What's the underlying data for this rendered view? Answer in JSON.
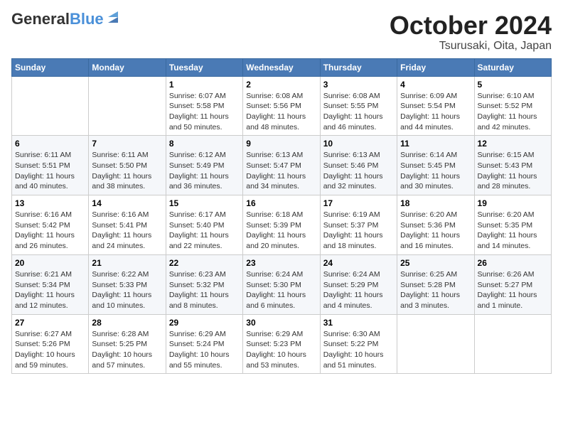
{
  "logo": {
    "line1": "General",
    "line2": "Blue"
  },
  "title": "October 2024",
  "subtitle": "Tsurusaki, Oita, Japan",
  "weekdays": [
    "Sunday",
    "Monday",
    "Tuesday",
    "Wednesday",
    "Thursday",
    "Friday",
    "Saturday"
  ],
  "weeks": [
    [
      {
        "day": "",
        "detail": ""
      },
      {
        "day": "",
        "detail": ""
      },
      {
        "day": "1",
        "detail": "Sunrise: 6:07 AM\nSunset: 5:58 PM\nDaylight: 11 hours and 50 minutes."
      },
      {
        "day": "2",
        "detail": "Sunrise: 6:08 AM\nSunset: 5:56 PM\nDaylight: 11 hours and 48 minutes."
      },
      {
        "day": "3",
        "detail": "Sunrise: 6:08 AM\nSunset: 5:55 PM\nDaylight: 11 hours and 46 minutes."
      },
      {
        "day": "4",
        "detail": "Sunrise: 6:09 AM\nSunset: 5:54 PM\nDaylight: 11 hours and 44 minutes."
      },
      {
        "day": "5",
        "detail": "Sunrise: 6:10 AM\nSunset: 5:52 PM\nDaylight: 11 hours and 42 minutes."
      }
    ],
    [
      {
        "day": "6",
        "detail": "Sunrise: 6:11 AM\nSunset: 5:51 PM\nDaylight: 11 hours and 40 minutes."
      },
      {
        "day": "7",
        "detail": "Sunrise: 6:11 AM\nSunset: 5:50 PM\nDaylight: 11 hours and 38 minutes."
      },
      {
        "day": "8",
        "detail": "Sunrise: 6:12 AM\nSunset: 5:49 PM\nDaylight: 11 hours and 36 minutes."
      },
      {
        "day": "9",
        "detail": "Sunrise: 6:13 AM\nSunset: 5:47 PM\nDaylight: 11 hours and 34 minutes."
      },
      {
        "day": "10",
        "detail": "Sunrise: 6:13 AM\nSunset: 5:46 PM\nDaylight: 11 hours and 32 minutes."
      },
      {
        "day": "11",
        "detail": "Sunrise: 6:14 AM\nSunset: 5:45 PM\nDaylight: 11 hours and 30 minutes."
      },
      {
        "day": "12",
        "detail": "Sunrise: 6:15 AM\nSunset: 5:43 PM\nDaylight: 11 hours and 28 minutes."
      }
    ],
    [
      {
        "day": "13",
        "detail": "Sunrise: 6:16 AM\nSunset: 5:42 PM\nDaylight: 11 hours and 26 minutes."
      },
      {
        "day": "14",
        "detail": "Sunrise: 6:16 AM\nSunset: 5:41 PM\nDaylight: 11 hours and 24 minutes."
      },
      {
        "day": "15",
        "detail": "Sunrise: 6:17 AM\nSunset: 5:40 PM\nDaylight: 11 hours and 22 minutes."
      },
      {
        "day": "16",
        "detail": "Sunrise: 6:18 AM\nSunset: 5:39 PM\nDaylight: 11 hours and 20 minutes."
      },
      {
        "day": "17",
        "detail": "Sunrise: 6:19 AM\nSunset: 5:37 PM\nDaylight: 11 hours and 18 minutes."
      },
      {
        "day": "18",
        "detail": "Sunrise: 6:20 AM\nSunset: 5:36 PM\nDaylight: 11 hours and 16 minutes."
      },
      {
        "day": "19",
        "detail": "Sunrise: 6:20 AM\nSunset: 5:35 PM\nDaylight: 11 hours and 14 minutes."
      }
    ],
    [
      {
        "day": "20",
        "detail": "Sunrise: 6:21 AM\nSunset: 5:34 PM\nDaylight: 11 hours and 12 minutes."
      },
      {
        "day": "21",
        "detail": "Sunrise: 6:22 AM\nSunset: 5:33 PM\nDaylight: 11 hours and 10 minutes."
      },
      {
        "day": "22",
        "detail": "Sunrise: 6:23 AM\nSunset: 5:32 PM\nDaylight: 11 hours and 8 minutes."
      },
      {
        "day": "23",
        "detail": "Sunrise: 6:24 AM\nSunset: 5:30 PM\nDaylight: 11 hours and 6 minutes."
      },
      {
        "day": "24",
        "detail": "Sunrise: 6:24 AM\nSunset: 5:29 PM\nDaylight: 11 hours and 4 minutes."
      },
      {
        "day": "25",
        "detail": "Sunrise: 6:25 AM\nSunset: 5:28 PM\nDaylight: 11 hours and 3 minutes."
      },
      {
        "day": "26",
        "detail": "Sunrise: 6:26 AM\nSunset: 5:27 PM\nDaylight: 11 hours and 1 minute."
      }
    ],
    [
      {
        "day": "27",
        "detail": "Sunrise: 6:27 AM\nSunset: 5:26 PM\nDaylight: 10 hours and 59 minutes."
      },
      {
        "day": "28",
        "detail": "Sunrise: 6:28 AM\nSunset: 5:25 PM\nDaylight: 10 hours and 57 minutes."
      },
      {
        "day": "29",
        "detail": "Sunrise: 6:29 AM\nSunset: 5:24 PM\nDaylight: 10 hours and 55 minutes."
      },
      {
        "day": "30",
        "detail": "Sunrise: 6:29 AM\nSunset: 5:23 PM\nDaylight: 10 hours and 53 minutes."
      },
      {
        "day": "31",
        "detail": "Sunrise: 6:30 AM\nSunset: 5:22 PM\nDaylight: 10 hours and 51 minutes."
      },
      {
        "day": "",
        "detail": ""
      },
      {
        "day": "",
        "detail": ""
      }
    ]
  ]
}
